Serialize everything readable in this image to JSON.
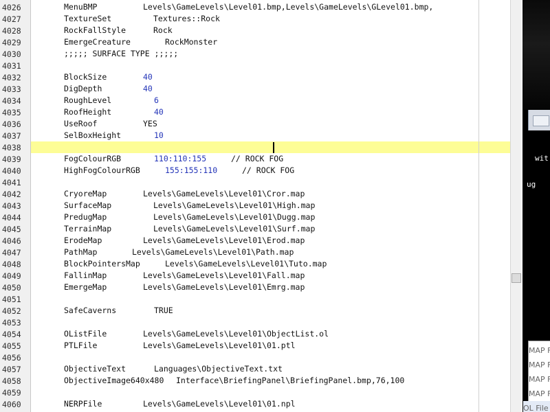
{
  "editor": {
    "lines": [
      {
        "n": "4026",
        "key": "MenuBMP",
        "val": "Levels\\GameLevels\\Level01.bmp,Levels\\GameLevels\\GLevel01.bmp,"
      },
      {
        "n": "4027",
        "key": "TextureSet",
        "val": "Textures::Rock"
      },
      {
        "n": "4028",
        "key": "RockFallStyle",
        "val": "Rock"
      },
      {
        "n": "4029",
        "key": "EmergeCreature",
        "val": "RockMonster"
      },
      {
        "n": "4030",
        "key": ";;;;; SURFACE TYPE ;;;;;",
        "val": ""
      },
      {
        "n": "4031",
        "key": "",
        "val": ""
      },
      {
        "n": "4032",
        "key": "BlockSize",
        "val": "40"
      },
      {
        "n": "4033",
        "key": "DigDepth",
        "val": "40"
      },
      {
        "n": "4034",
        "key": "RoughLevel",
        "val": "6"
      },
      {
        "n": "4035",
        "key": "RoofHeight",
        "val": "40"
      },
      {
        "n": "4036",
        "key": "UseRoof",
        "val": "YES"
      },
      {
        "n": "4037",
        "key": "SelBoxHeight",
        "val": "10"
      },
      {
        "n": "4038",
        "key": "",
        "val": ""
      },
      {
        "n": "4039",
        "key": "FogColourRGB",
        "val": "110:110:155",
        "comment": "// ROCK FOG"
      },
      {
        "n": "4040",
        "key": "HighFogColourRGB",
        "val": "155:155:110",
        "comment": "// ROCK FOG"
      },
      {
        "n": "4041",
        "key": "",
        "val": ""
      },
      {
        "n": "4042",
        "key": "CryoreMap",
        "val": "Levels\\GameLevels\\Level01\\Cror.map"
      },
      {
        "n": "4043",
        "key": "SurfaceMap",
        "val": "Levels\\GameLevels\\Level01\\High.map"
      },
      {
        "n": "4044",
        "key": "PredugMap",
        "val": "Levels\\GameLevels\\Level01\\Dugg.map"
      },
      {
        "n": "4045",
        "key": "TerrainMap",
        "val": "Levels\\GameLevels\\Level01\\Surf.map"
      },
      {
        "n": "4046",
        "key": "ErodeMap",
        "val": "Levels\\GameLevels\\Level01\\Erod.map"
      },
      {
        "n": "4047",
        "key": "PathMap",
        "val": "Levels\\GameLevels\\Level01\\Path.map"
      },
      {
        "n": "4048",
        "key": "BlockPointersMap",
        "val": "Levels\\GameLevels\\Level01\\Tuto.map"
      },
      {
        "n": "4049",
        "key": "FallinMap",
        "val": "Levels\\GameLevels\\Level01\\Fall.map"
      },
      {
        "n": "4050",
        "key": "EmergeMap",
        "val": "Levels\\GameLevels\\Level01\\Emrg.map"
      },
      {
        "n": "4051",
        "key": "",
        "val": ""
      },
      {
        "n": "4052",
        "key": "SafeCaverns",
        "val": "TRUE"
      },
      {
        "n": "4053",
        "key": "",
        "val": ""
      },
      {
        "n": "4054",
        "key": "OListFile",
        "val": "Levels\\GameLevels\\Level01\\ObjectList.ol"
      },
      {
        "n": "4055",
        "key": "PTLFile",
        "val": "Levels\\GameLevels\\Level01\\01.ptl"
      },
      {
        "n": "4056",
        "key": "",
        "val": ""
      },
      {
        "n": "4057",
        "key": "ObjectiveText",
        "val": "Languages\\ObjectiveText.txt"
      },
      {
        "n": "4058",
        "key": "ObjectiveImage640x480",
        "val": "Interface\\BriefingPanel\\BriefingPanel.bmp,76,100"
      },
      {
        "n": "4059",
        "key": "",
        "val": ""
      },
      {
        "n": "4060",
        "key": "NERPFile",
        "val": "Levels\\GameLevels\\Level01\\01.npl"
      }
    ],
    "current_line": "4038",
    "scroll_position": 0.68
  },
  "background_window": {
    "text_1": "wit",
    "text_2": "ug",
    "list_items": [
      "MAP F",
      "MAP F",
      "MAP F",
      "MAP F",
      "OL File"
    ]
  },
  "colors": {
    "number": "#2334b8",
    "current_line": "#fdfd96",
    "gutter": "#f0f0f0"
  }
}
